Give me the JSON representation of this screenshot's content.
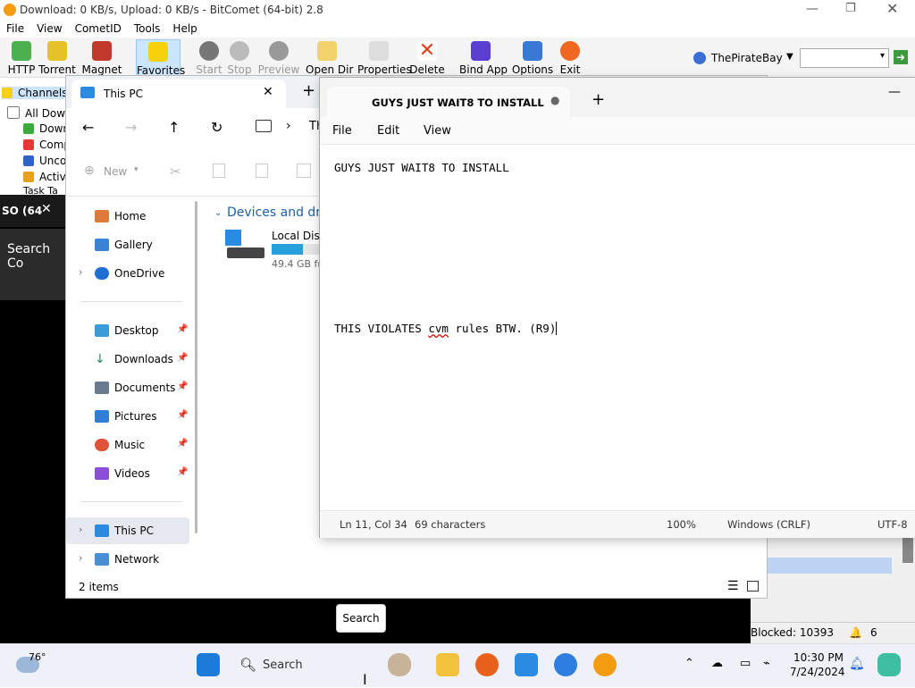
{
  "bitcomet": {
    "title": "Download: 0 KB/s, Upload: 0 KB/s - BitComet (64-bit) 2.8",
    "menu": [
      "File",
      "View",
      "CometID",
      "Tools",
      "Help"
    ],
    "toolbar": [
      "HTTP",
      "Torrent",
      "Magnet",
      "Favorites",
      "Start",
      "Stop",
      "Preview",
      "Open Dir",
      "Properties",
      "Delete",
      "Bind App",
      "Options",
      "Exit"
    ],
    "search_site": "ThePirateBay",
    "tree": [
      "Channels",
      "All Down",
      "Down",
      "Comp",
      "Unco",
      "Activ",
      "Task Ta"
    ],
    "blocked": "Blocked: 10393",
    "count": "6"
  },
  "dark_app": {
    "tab_label": "SO (64",
    "search_label": "Search Co"
  },
  "explorer": {
    "tab_title": "This PC",
    "breadcrumb_partial": "Th",
    "new_label": "New",
    "section_title": "Devices and driv",
    "drive": {
      "name": "Local Disk",
      "free": "49.4 GB fre",
      "used_fraction": 0.62
    },
    "sidebar": [
      {
        "label": "Home",
        "icon": "home-icon",
        "pin": false
      },
      {
        "label": "Gallery",
        "icon": "gallery-icon",
        "pin": false
      },
      {
        "label": "OneDrive",
        "icon": "onedrive-icon",
        "pin": false
      },
      {
        "label": "Desktop",
        "icon": "desktop-icon",
        "pin": true
      },
      {
        "label": "Downloads",
        "icon": "downloads-icon",
        "pin": true
      },
      {
        "label": "Documents",
        "icon": "documents-icon",
        "pin": true
      },
      {
        "label": "Pictures",
        "icon": "pictures-icon",
        "pin": true
      },
      {
        "label": "Music",
        "icon": "music-icon",
        "pin": true
      },
      {
        "label": "Videos",
        "icon": "videos-icon",
        "pin": true
      },
      {
        "label": "This PC",
        "icon": "this-pc-icon",
        "pin": false
      },
      {
        "label": "Network",
        "icon": "network-icon",
        "pin": false
      }
    ],
    "status": "2 items"
  },
  "notepad": {
    "tab_title": "GUYS JUST WAIT8 TO INSTALL",
    "menu": [
      "File",
      "Edit",
      "View"
    ],
    "line1": "GUYS JUST WAIT8 TO INSTALL",
    "line2_a": "THIS VIOLATES ",
    "line2_b": "cvm",
    "line2_c": " rules BTW. (R9)",
    "status": {
      "position": "Ln 11, Col 34",
      "chars": "69 characters",
      "zoom": "100%",
      "eol": "Windows (CRLF)",
      "encoding": "UTF-8"
    }
  },
  "search_tooltip": "Search",
  "taskbar": {
    "weather": "76°",
    "search": "Search",
    "time": "10:30 PM",
    "date": "7/24/2024"
  }
}
